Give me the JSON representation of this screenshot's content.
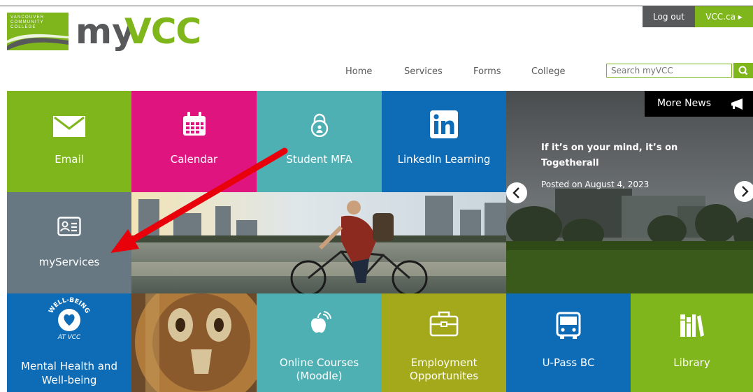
{
  "logo": {
    "badge_lines": [
      "VANCOUVER",
      "COMMUNITY",
      "COLLEGE"
    ],
    "my": "my",
    "vcc": "VCC"
  },
  "top_buttons": {
    "logout": "Log out",
    "vccca": "VCC.ca ▸"
  },
  "nav": {
    "items": [
      "Home",
      "Services",
      "Forms",
      "College"
    ],
    "search_placeholder": "Search myVCC"
  },
  "tiles": {
    "email": "Email",
    "calendar": "Calendar",
    "student_mfa": "Student MFA",
    "linkedin": "LinkedIn Learning",
    "myservices": "myServices",
    "mental_health": "Mental Health and\nWell-being",
    "online_courses": "Online Courses\n(Moodle)",
    "employment": "Employment\nOpportunites",
    "upass": "U-Pass BC",
    "library": "Library"
  },
  "wellbeing_badge": {
    "top": "WELL-BEING",
    "bottom": "AT VCC"
  },
  "news": {
    "more_news": "More News",
    "title": "If it’s on your mind, it’s on Togetherall",
    "date": "Posted on August 4, 2023"
  },
  "colors": {
    "green": "#7fb61c",
    "magenta": "#e0147f",
    "teal": "#4fb0b4",
    "blue": "#0e6cb7",
    "slate": "#677882",
    "olive": "#a4a91b",
    "dark_gray": "#58595b",
    "annotation_arrow": "#e8000b"
  }
}
